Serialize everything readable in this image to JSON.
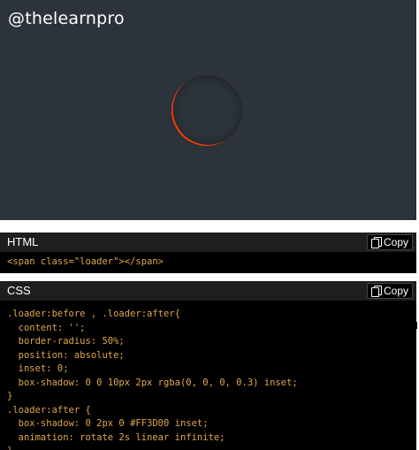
{
  "preview": {
    "watermark": "@thelearnpro",
    "background": "#2c333a",
    "loader_accent": "#FF3D00"
  },
  "html_panel": {
    "title": "HTML",
    "copy_label": "Copy",
    "code": "<span class=\"loader\"></span>"
  },
  "css_panel": {
    "title": "CSS",
    "copy_label": "Copy",
    "lines": [
      ".loader:before , .loader:after{",
      "  content: '';",
      "  border-radius: 50%;",
      "  position: absolute;",
      "  inset: 0;",
      "  box-shadow: 0 0 10px 2px rgba(0, 0, 0, 0.3) inset;",
      "}",
      ".loader:after {",
      "  box-shadow: 0 2px 0 #FF3D00 inset;",
      "  animation: rotate 2s linear infinite;",
      "}"
    ]
  },
  "colors": {
    "code_text": "#e0a84a",
    "panel_header": "#1e1e1e",
    "panel_body": "#000000"
  }
}
